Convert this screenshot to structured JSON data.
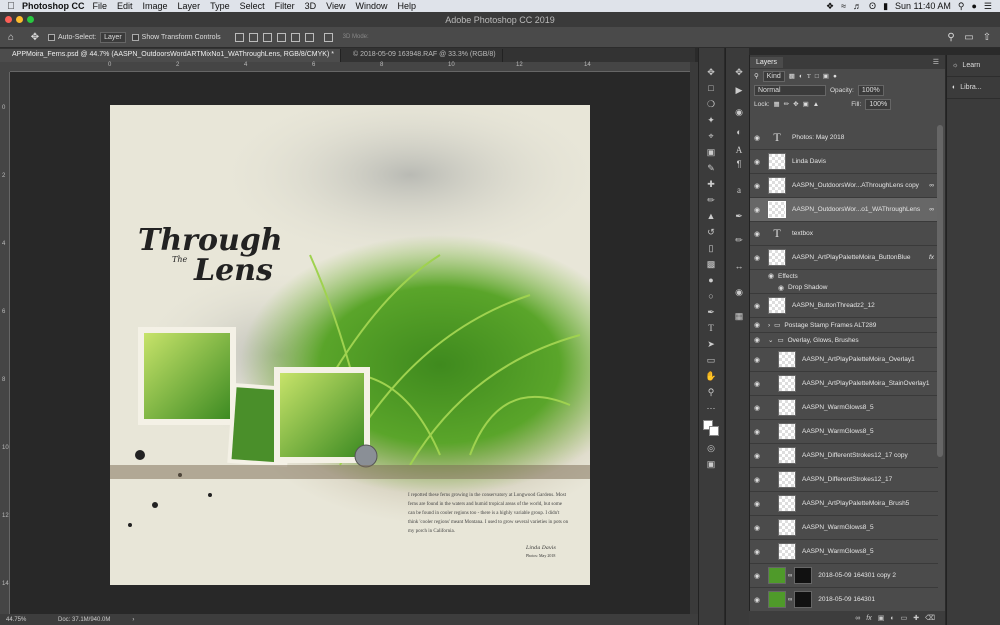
{
  "menubar": {
    "app": "Photoshop CC",
    "items": [
      "File",
      "Edit",
      "Image",
      "Layer",
      "Type",
      "Select",
      "Filter",
      "3D",
      "View",
      "Window",
      "Help"
    ],
    "clock": "Sun 11:40 AM"
  },
  "window": {
    "title": "Adobe Photoshop CC 2019"
  },
  "options": {
    "auto_select_label": "Auto-Select:",
    "auto_select_value": "Layer",
    "transform_label": "Show Transform Controls",
    "mode3d": "3D Mode:"
  },
  "tabs": [
    "APPMoira_Ferns.psd @ 44.7% (AASPN_OutdoorsWordARTMixNo1_WAThroughLens, RGB/8/CMYK) *",
    "© 2018-05-09 163948.RAF @ 33.3% (RGB/8)"
  ],
  "ruler": {
    "h": [
      "0",
      "2",
      "4",
      "6",
      "8",
      "10",
      "12",
      "14"
    ],
    "v": [
      "0",
      "2",
      "4",
      "6",
      "8",
      "10",
      "12",
      "14"
    ]
  },
  "status": {
    "zoom": "44.75%",
    "doc": "Doc: 37.1M/940.0M"
  },
  "artwork": {
    "title_through": "Through",
    "title_the": "The",
    "title_lens": "Lens",
    "journal": "I repotted these ferns growing in the conservatory at Longwood Gardens. Most ferns are found in the waters and humid tropical areas of the world, but some can be found in cooler regions too - there is a highly variable group. I didn't think 'cooler regions' meant Montana. I used to grow several varieties in pots on my porch in California.",
    "signature": "Linda Davis",
    "date": "Photos: May 2018"
  },
  "panel": {
    "tab": "Layers",
    "kind": "Kind",
    "blend": "Normal",
    "opacity_label": "Opacity:",
    "opacity": "100%",
    "lock_label": "Lock:",
    "fill_label": "Fill:",
    "fill": "100%"
  },
  "layers": [
    {
      "name": "Photos: May 2018",
      "type": "text"
    },
    {
      "name": "Linda Davis",
      "type": "pixel"
    },
    {
      "name": "AASPN_OutdoorsWor...AThroughLens copy",
      "type": "pixel"
    },
    {
      "name": "AASPN_OutdoorsWor...o1_WAThroughLens",
      "type": "pixel"
    },
    {
      "name": "textbox",
      "type": "text"
    },
    {
      "name": "AASPN_ArtPlayPaletteMoira_ButtonBlue",
      "type": "pixel",
      "fx": "fx"
    },
    {
      "name": "Effects",
      "type": "effect"
    },
    {
      "name": "Drop Shadow",
      "type": "effect"
    },
    {
      "name": "AASPN_ButtonThreadz2_12",
      "type": "pixel"
    },
    {
      "name": "Postage Stamp Frames ALT289",
      "type": "group"
    },
    {
      "name": "Overlay, Glows, Brushes",
      "type": "group"
    },
    {
      "name": "AASPN_ArtPlayPaletteMoira_Overlay1",
      "type": "pixel"
    },
    {
      "name": "AASPN_ArtPlayPaletteMoira_StainOverlay1",
      "type": "pixel"
    },
    {
      "name": "AASPN_WarmGlows8_5",
      "type": "pixel"
    },
    {
      "name": "AASPN_WarmGlows8_5",
      "type": "pixel"
    },
    {
      "name": "AASPN_DifferentStrokes12_17 copy",
      "type": "pixel"
    },
    {
      "name": "AASPN_DifferentStrokes12_17",
      "type": "pixel"
    },
    {
      "name": "AASPN_ArtPlayPaletteMoira_Brush5",
      "type": "pixel"
    },
    {
      "name": "AASPN_WarmGlows8_5",
      "type": "pixel"
    },
    {
      "name": "AASPN_WarmGlows8_5",
      "type": "pixel"
    },
    {
      "name": "2018-05-09 164301 copy 2",
      "type": "photo"
    },
    {
      "name": "2018-05-09 164301",
      "type": "photo"
    }
  ],
  "rightcol": {
    "learn": "Learn",
    "libraries": "Libra..."
  }
}
